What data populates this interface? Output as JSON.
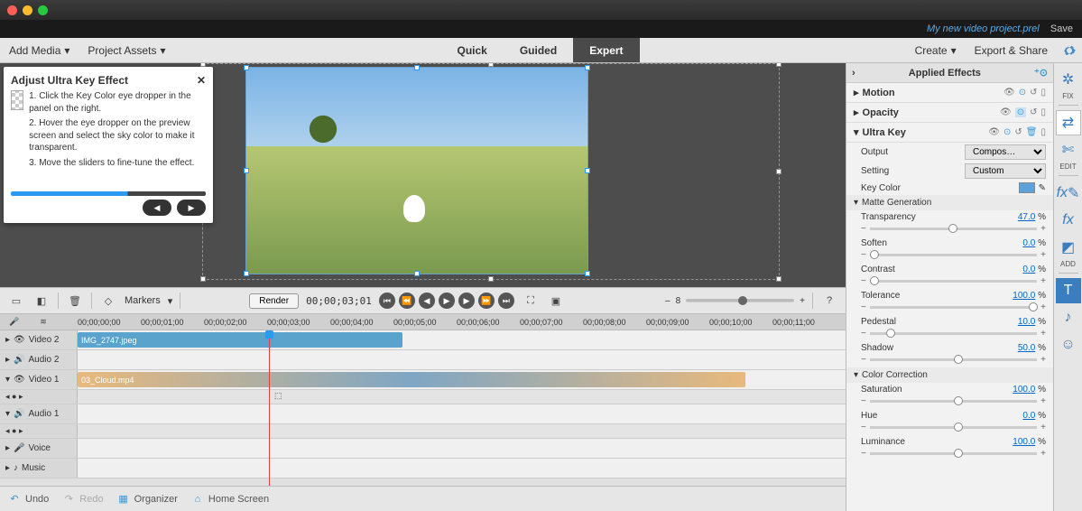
{
  "project_file": "My new video project.prel",
  "save": "Save",
  "menu": {
    "add_media": "Add Media",
    "project_assets": "Project Assets",
    "create": "Create",
    "export": "Export & Share"
  },
  "modes": {
    "quick": "Quick",
    "guided": "Guided",
    "expert": "Expert",
    "active": "expert"
  },
  "hint": {
    "title": "Adjust Ultra Key Effect",
    "s1": "1. Click the Key Color eye dropper in the panel on the right.",
    "s2": "2. Hover the eye dropper on the preview screen and select the sky color to make it transparent.",
    "s3": "3. Move the sliders to fine-tune the effect."
  },
  "toolbar": {
    "markers": "Markers",
    "render": "Render",
    "timecode": "00;00;03;01"
  },
  "ruler": [
    "00;00;00;00",
    "00;00;01;00",
    "00;00;02;00",
    "00;00;03;00",
    "00;00;04;00",
    "00;00;05;00",
    "00;00;06;00",
    "00;00;07;00",
    "00;00;08;00",
    "00;00;09;00",
    "00;00;10;00",
    "00;00;11;00"
  ],
  "tracks": {
    "video2": "Video 2",
    "audio2": "Audio 2",
    "video1": "Video 1",
    "audio1": "Audio 1",
    "voice": "Voice",
    "music": "Music",
    "clip_img": "IMG_2747.jpeg",
    "clip_cloud": "03_Cloud.mp4"
  },
  "bottom": {
    "undo": "Undo",
    "redo": "Redo",
    "organizer": "Organizer",
    "home": "Home Screen"
  },
  "panel": {
    "title": "Applied Effects",
    "motion": "Motion",
    "opacity": "Opacity",
    "ultra": "Ultra Key",
    "output": "Output",
    "output_v": "Compos…",
    "setting": "Setting",
    "setting_v": "Custom",
    "key_color": "Key Color",
    "matte": "Matte Generation",
    "transparency": "Transparency",
    "transparency_v": "47.0",
    "soften": "Soften",
    "soften_v": "0.0",
    "contrast": "Contrast",
    "contrast_v": "0.0",
    "tolerance": "Tolerance",
    "tolerance_v": "100.0",
    "pedestal": "Pedestal",
    "pedestal_v": "10.0",
    "shadow": "Shadow",
    "shadow_v": "50.0",
    "cc": "Color Correction",
    "sat": "Saturation",
    "sat_v": "100.0",
    "hue": "Hue",
    "hue_v": "0.0",
    "lum": "Luminance",
    "lum_v": "100.0",
    "pct": "%"
  },
  "rail": {
    "fix": "FIX",
    "edit": "EDIT",
    "add": "ADD"
  }
}
